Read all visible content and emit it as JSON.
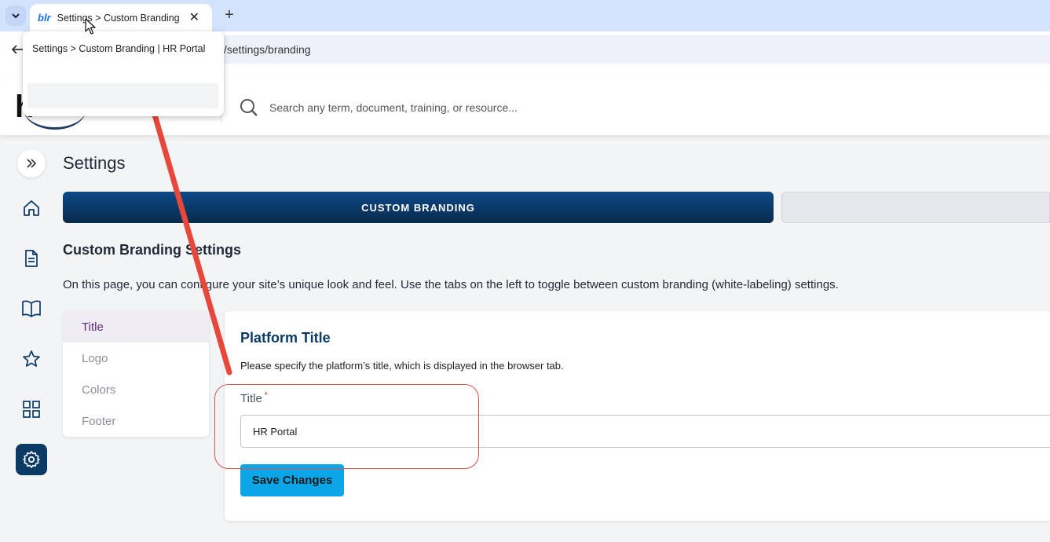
{
  "browser": {
    "tab_title": "Settings > Custom Branding | HR Portal",
    "tab_favicon": "blr",
    "url": "/settings/branding",
    "tooltip": "Settings > Custom Branding | HR Portal"
  },
  "header": {
    "logo_letter": "h",
    "search_placeholder": "Search any term, document, training, or resource..."
  },
  "sidebar": {
    "items": [
      {
        "name": "expand",
        "icon": "double-chevron-right-icon"
      },
      {
        "name": "home",
        "icon": "home-icon"
      },
      {
        "name": "documents",
        "icon": "document-icon"
      },
      {
        "name": "training",
        "icon": "book-icon"
      },
      {
        "name": "favorites",
        "icon": "star-icon"
      },
      {
        "name": "apps",
        "icon": "grid-icon"
      },
      {
        "name": "settings",
        "icon": "gear-icon",
        "active": true
      }
    ]
  },
  "main": {
    "page_title": "Settings",
    "tabs": [
      {
        "label": "CUSTOM BRANDING",
        "active": true
      },
      {
        "label": "",
        "active": false
      }
    ],
    "section_heading": "Custom Branding Settings",
    "section_description": "On this page, you can configure your site’s unique look and feel. Use the tabs on the left to toggle between custom branding (white-labeling) settings.",
    "subnav": [
      {
        "label": "Title",
        "active": true
      },
      {
        "label": "Logo",
        "active": false
      },
      {
        "label": "Colors",
        "active": false
      },
      {
        "label": "Footer",
        "active": false
      }
    ],
    "panel": {
      "title": "Platform Title",
      "description": "Please specify the platform’s title, which is displayed in the browser tab.",
      "field_label": "Title",
      "required_mark": "*",
      "field_value": "HR Portal",
      "save_label": "Save Changes"
    }
  },
  "colors": {
    "accent_navy": "#0b3a66",
    "save_button": "#0aa6e8",
    "subnav_active_text": "#5b2a86",
    "annotation_red": "#e8473b"
  }
}
